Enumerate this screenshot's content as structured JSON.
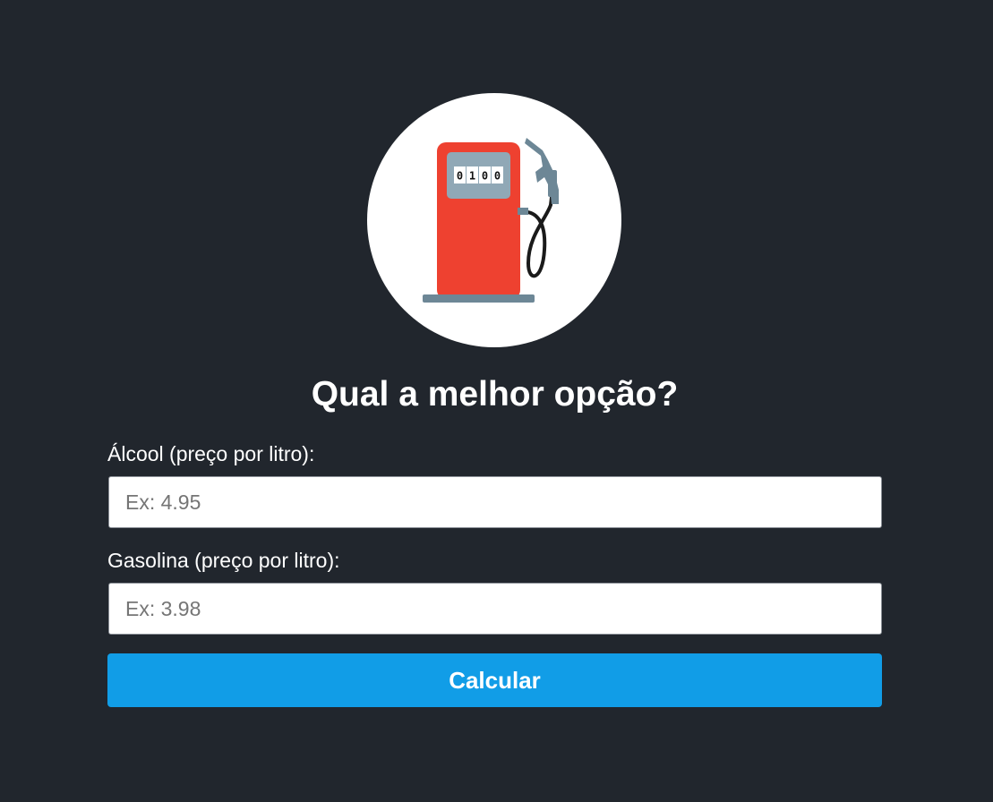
{
  "logo": {
    "icon": "fuel-pump-icon",
    "meter_digits": [
      "0",
      "1",
      "0",
      "0"
    ],
    "colors": {
      "pump_body": "#ee4130",
      "pump_meter": "#90a8b6",
      "nozzle": "#6d8796",
      "hose": "#1a1a1a",
      "base": "#6d8796"
    }
  },
  "title": "Qual a melhor opção?",
  "form": {
    "alcool": {
      "label": "Álcool (preço por litro):",
      "placeholder": "Ex: 4.95",
      "value": ""
    },
    "gasolina": {
      "label": "Gasolina (preço por litro):",
      "placeholder": "Ex: 3.98",
      "value": ""
    },
    "submit_label": "Calcular"
  },
  "colors": {
    "background": "#21262d",
    "accent": "#119de7",
    "text": "#ffffff"
  }
}
